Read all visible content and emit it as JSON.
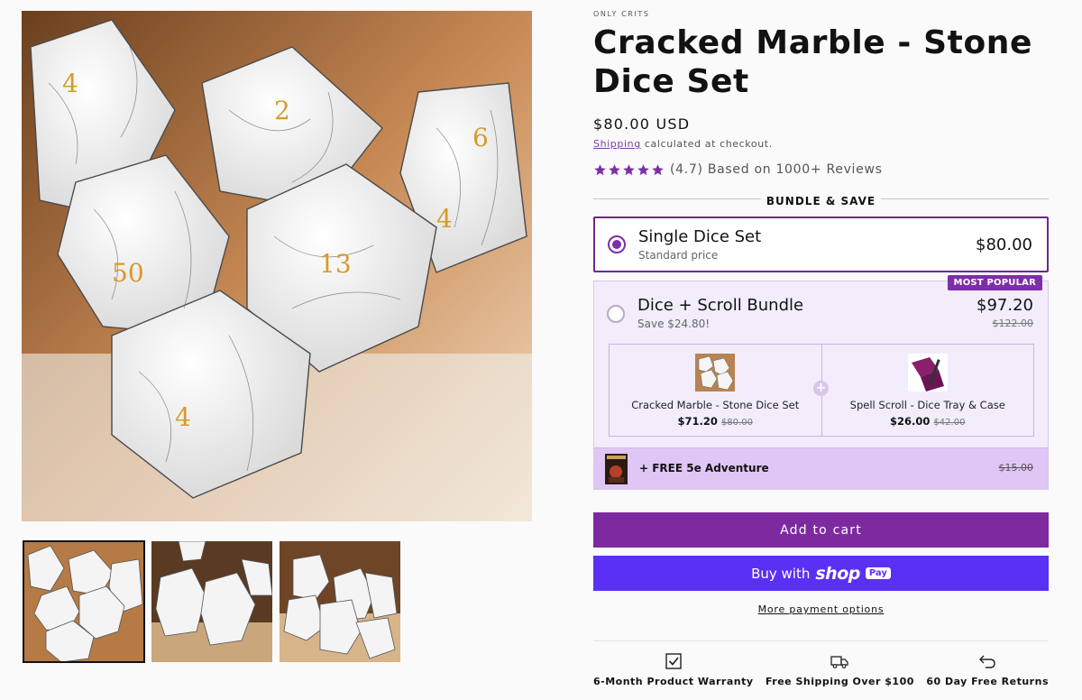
{
  "product": {
    "vendor": "ONLY CRITS",
    "title": "Cracked Marble - Stone Dice Set",
    "price": "$80.00 USD",
    "shipping_link": "Shipping",
    "shipping_note": "calculated at checkout.",
    "rating_text": "(4.7) Based on 1000+ Reviews",
    "rating_value": 4.7,
    "star_count": 5
  },
  "bundle": {
    "heading": "BUNDLE & SAVE",
    "option1": {
      "name": "Single Dice Set",
      "sub": "Standard price",
      "price": "$80.00",
      "selected": true
    },
    "option2": {
      "badge": "MOST POPULAR",
      "name": "Dice + Scroll Bundle",
      "sub": "Save $24.80!",
      "price": "$97.20",
      "compare": "$122.00",
      "selected": false,
      "items": [
        {
          "name": "Cracked Marble - Stone Dice Set",
          "price": "$71.20",
          "compare": "$80.00",
          "icon": "dice-thumbnail"
        },
        {
          "name": "Spell Scroll - Dice Tray & Case",
          "price": "$26.00",
          "compare": "$42.00",
          "icon": "dice-tray-thumbnail"
        }
      ],
      "plus_symbol": "+",
      "free_label": "+ FREE 5e Adventure",
      "free_price": "$15.00"
    }
  },
  "actions": {
    "add_to_cart": "Add to cart",
    "buy_with": "Buy with",
    "shop_word": "shop",
    "pay_word": "Pay",
    "more_payment": "More payment options"
  },
  "perks": [
    {
      "label": "6-Month Product Warranty",
      "icon": "checkbox-icon"
    },
    {
      "label": "Free Shipping Over $100",
      "icon": "truck-icon"
    },
    {
      "label": "60 Day Free Returns",
      "icon": "return-arrow-icon"
    }
  ],
  "colors": {
    "accent": "#7d2aa0",
    "shop_pay": "#5a31f4",
    "bundle_bg": "#f3ecfb",
    "free_row_bg": "#e0c6f5",
    "star": "#7d2ea8"
  }
}
